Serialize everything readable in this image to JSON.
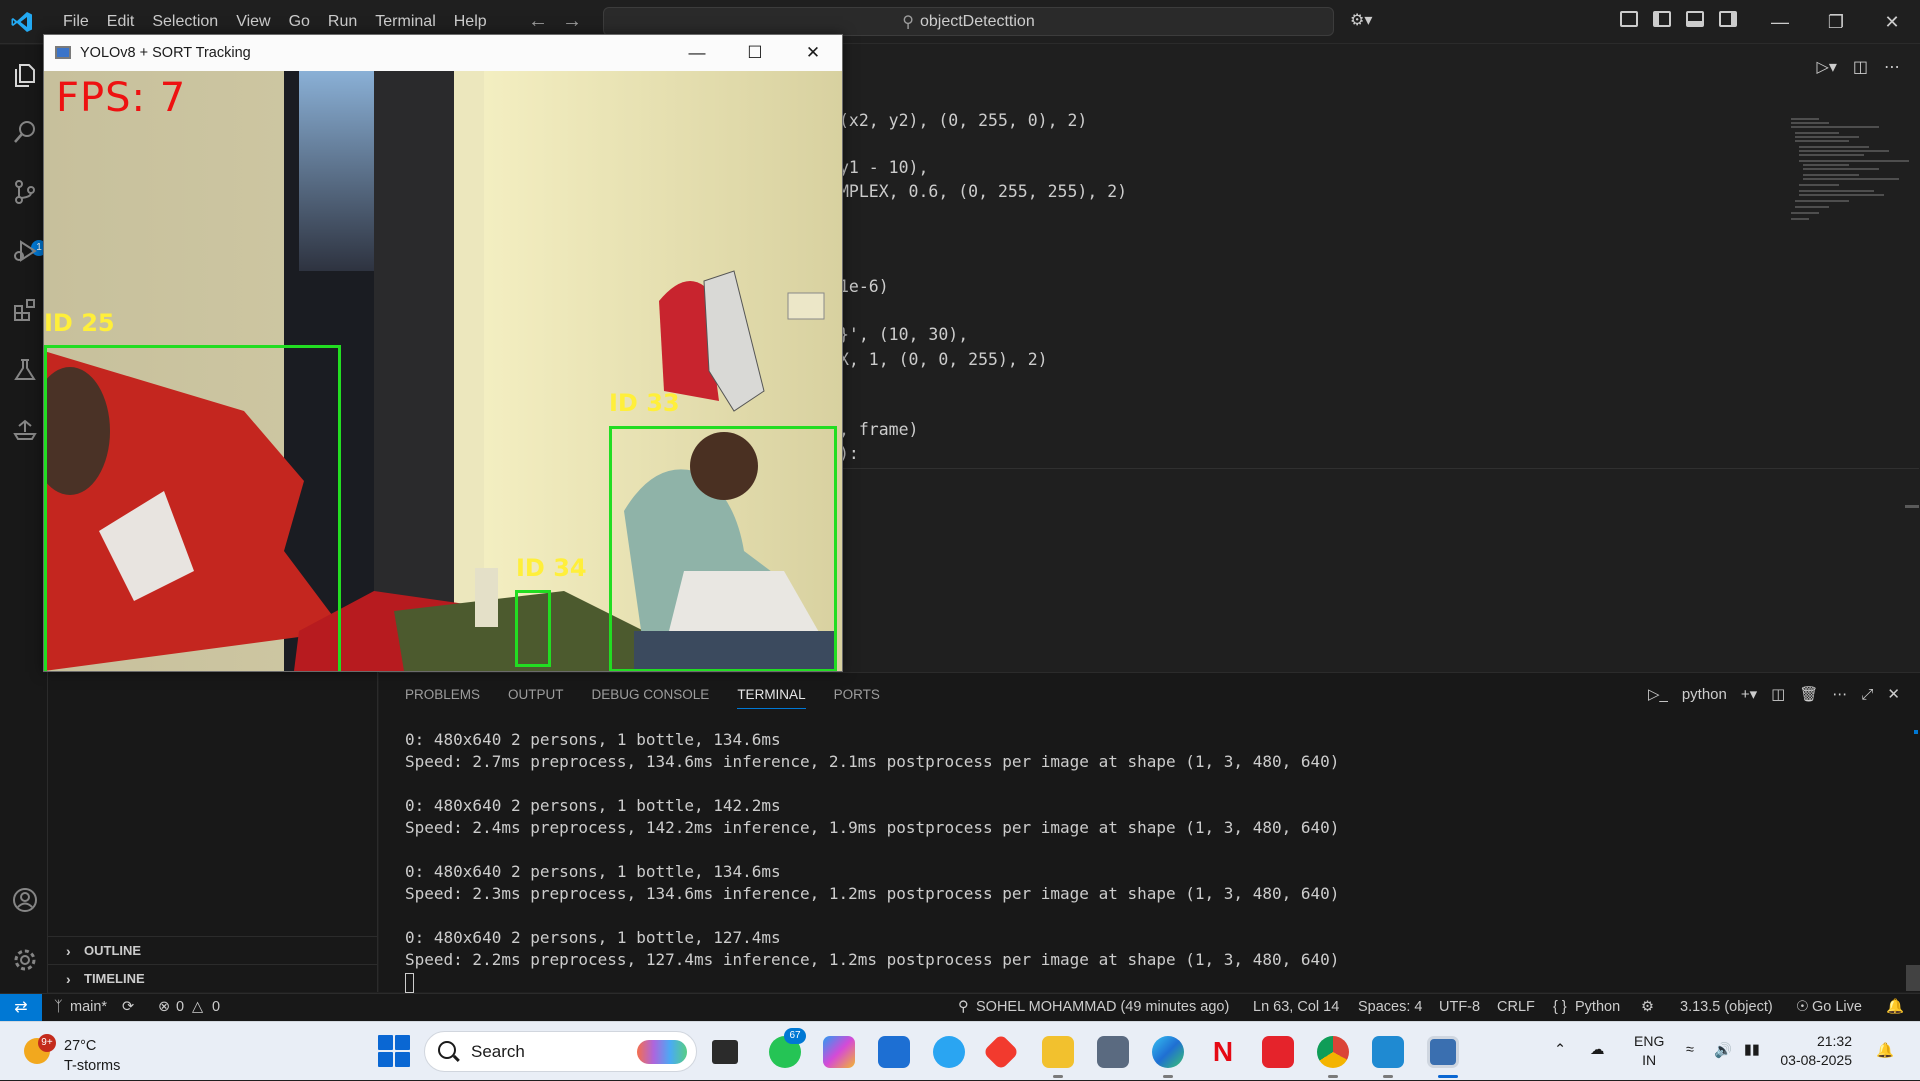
{
  "titlebar": {
    "menu": [
      "File",
      "Edit",
      "Selection",
      "View",
      "Go",
      "Run",
      "Terminal",
      "Help"
    ],
    "command_center": "objectDetecttion"
  },
  "editor": {
    "code_fragments": [
      "(x2, y2), (0, 255, 0), 2)",
      "y1 - 10),",
      "MPLEX, 0.6, (0, 255, 255), 2)",
      "1e-6)",
      "}', (10, 30),",
      "X, 1, (0, 0, 255), 2)",
      ", frame)",
      "):"
    ]
  },
  "cv_window": {
    "title": "YOLOv8 + SORT Tracking",
    "fps_label": "FPS: 7",
    "tracks": [
      {
        "label": "ID 25",
        "color": "#22dd22"
      },
      {
        "label": "ID 34",
        "color": "#22dd22"
      },
      {
        "label": "ID 33",
        "color": "#22dd22"
      }
    ]
  },
  "sidebar": {
    "outline_label": "OUTLINE",
    "timeline_label": "TIMELINE"
  },
  "panel": {
    "tabs": [
      "PROBLEMS",
      "OUTPUT",
      "DEBUG CONSOLE",
      "TERMINAL",
      "PORTS"
    ],
    "active_tab": "TERMINAL",
    "terminal_shell": "python",
    "terminal_lines": [
      "0: 480x640 2 persons, 1 bottle, 134.6ms",
      "Speed: 2.7ms preprocess, 134.6ms inference, 2.1ms postprocess per image at shape (1, 3, 480, 640)",
      "",
      "0: 480x640 2 persons, 1 bottle, 142.2ms",
      "Speed: 2.4ms preprocess, 142.2ms inference, 1.9ms postprocess per image at shape (1, 3, 480, 640)",
      "",
      "0: 480x640 2 persons, 1 bottle, 134.6ms",
      "Speed: 2.3ms preprocess, 134.6ms inference, 1.2ms postprocess per image at shape (1, 3, 480, 640)",
      "",
      "0: 480x640 2 persons, 1 bottle, 127.4ms",
      "Speed: 2.2ms preprocess, 127.4ms inference, 1.2ms postprocess per image at shape (1, 3, 480, 640)"
    ]
  },
  "statusbar": {
    "branch": "main*",
    "errors": "0",
    "warnings": "0",
    "blame": "SOHEL MOHAMMAD (49 minutes ago)",
    "cursor_pos": "Ln 63, Col 14",
    "spaces": "Spaces: 4",
    "encoding": "UTF-8",
    "eol": "CRLF",
    "language": "Python",
    "interpreter": "3.13.5 (object)",
    "go_live": "Go Live"
  },
  "taskbar": {
    "weather_temp": "27°C",
    "weather_cond": "T-storms",
    "weather_badge": "9+",
    "search_placeholder": "Search",
    "whatsapp_badge": "67",
    "lang_line1": "ENG",
    "lang_line2": "IN",
    "time": "21:32",
    "date": "03-08-2025"
  },
  "colors": {
    "vscode_accent": "#0078d4",
    "bbox_green": "#22dd22",
    "label_yellow": "#ffef3a",
    "fps_red": "#ee1111"
  },
  "icons": [
    "explorer-icon",
    "search-icon",
    "source-control-icon",
    "run-debug-icon",
    "extensions-icon",
    "testing-icon",
    "remote-explorer-icon",
    "accounts-icon",
    "settings-icon"
  ]
}
